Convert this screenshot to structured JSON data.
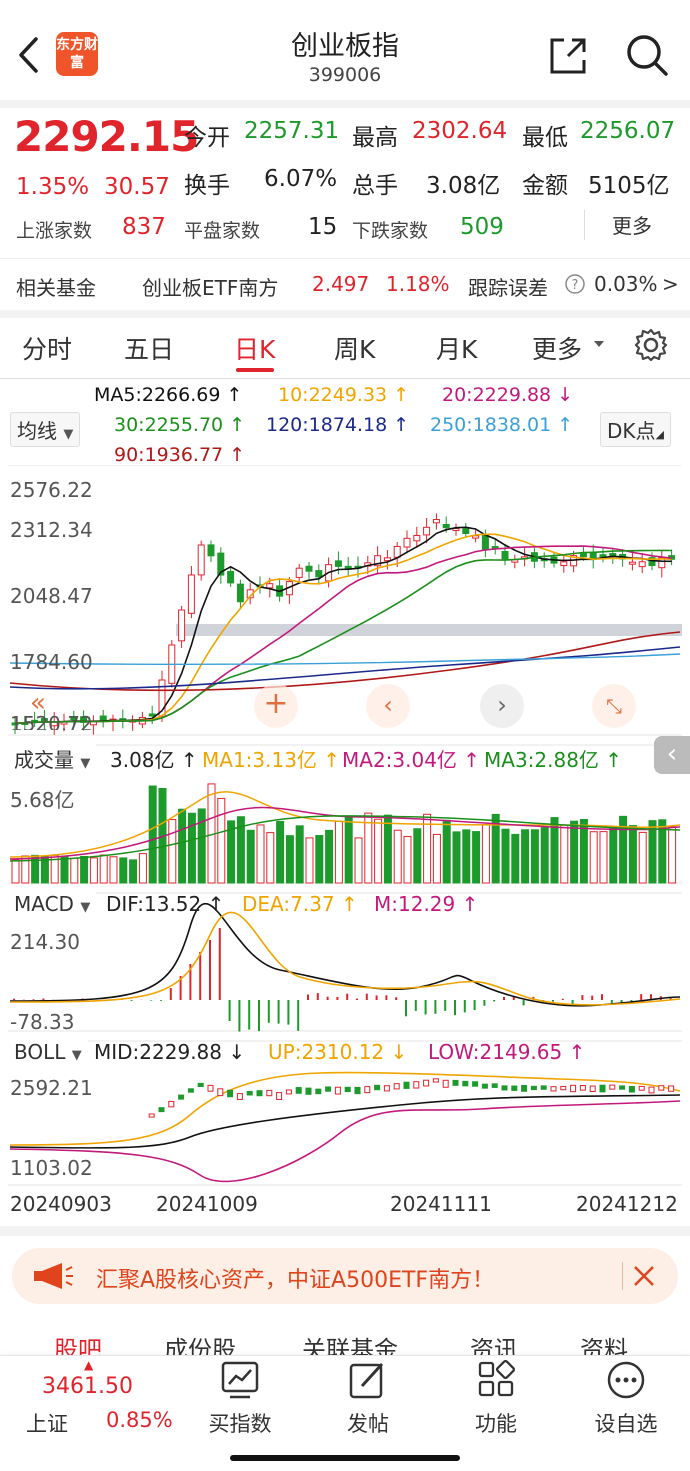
{
  "header": {
    "back_icon": "back-arrow-icon",
    "logo_text": "东方财富",
    "title": "创业板指",
    "code": "399006",
    "share_icon": "share-icon",
    "search_icon": "search-icon"
  },
  "quote": {
    "price": "2292.15",
    "change_pct": "1.35%",
    "change": "30.57",
    "open_label": "今开",
    "open": "2257.31",
    "high_label": "最高",
    "high": "2302.64",
    "low_label": "最低",
    "low": "2256.07",
    "turnover_label": "换手",
    "turnover": "6.07%",
    "volume_label": "总手",
    "volume": "3.08亿",
    "amount_label": "金额",
    "amount": "5105亿",
    "up_label": "上涨家数",
    "up": "837",
    "flat_label": "平盘家数",
    "flat": "15",
    "down_label": "下跌家数",
    "down": "509",
    "more": "更多"
  },
  "fund": {
    "label": "相关基金",
    "name": "创业板ETF南方",
    "price": "2.497",
    "change": "1.18%",
    "err_label": "跟踪误差",
    "err": "0.03%",
    "arrow": ">"
  },
  "tabs": [
    "分时",
    "五日",
    "日K",
    "周K",
    "月K",
    "更多"
  ],
  "active_tab": "日K",
  "ma": {
    "ma5": "MA5:2266.69 ↑",
    "ma10": "10:2249.33 ↑",
    "ma20": "20:2229.88 ↓",
    "ma30": "30:2255.70 ↑",
    "ma120": "120:1874.18 ↑",
    "ma250": "250:1838.01 ↑",
    "ma90": "90:1936.77 ↑",
    "selector": "均线",
    "dk": "DK点"
  },
  "price_axis": [
    "2576.22",
    "2312.34",
    "2048.47",
    "1784.60",
    "1520.72"
  ],
  "volume": {
    "selector": "成交量",
    "value": "3.08亿 ↑",
    "ma1": "MA1:3.13亿 ↑",
    "ma2": "MA2:3.04亿 ↑",
    "ma3": "MA3:2.88亿 ↑",
    "axis_top": "5.68亿"
  },
  "macd": {
    "selector": "MACD",
    "dif": "DIF:13.52 ↑",
    "dea": "DEA:7.37 ↑",
    "m": "M:12.29 ↑",
    "axis_top": "214.30",
    "axis_bottom": "-78.33"
  },
  "boll": {
    "selector": "BOLL",
    "mid": "MID:2229.88 ↓",
    "up": "UP:2310.12 ↓",
    "low": "LOW:2149.65 ↑",
    "axis_top": "2592.21",
    "axis_bottom": "1103.02"
  },
  "dates": [
    "20240903",
    "20241009",
    "20241111",
    "20241212"
  ],
  "ad": {
    "text": "汇聚A股核心资产，中证A500ETF南方！"
  },
  "subtabs": [
    "股吧",
    "成份股",
    "关联基金",
    "资讯",
    "资料"
  ],
  "bottom": {
    "index_value": "3461.50",
    "index_name": "上证",
    "index_change": "0.85%",
    "buy": "买指数",
    "post": "发帖",
    "func": "功能",
    "watch": "设自选"
  },
  "colors": {
    "up": "#e0242c",
    "down": "#1c9a2c",
    "ma5": "#111111",
    "ma10": "#f0a400",
    "ma20": "#c2197c",
    "ma30": "#1a8f1a",
    "ma120": "#1b2a8a",
    "ma250": "#3aa0d8",
    "ma90": "#b01818"
  }
}
